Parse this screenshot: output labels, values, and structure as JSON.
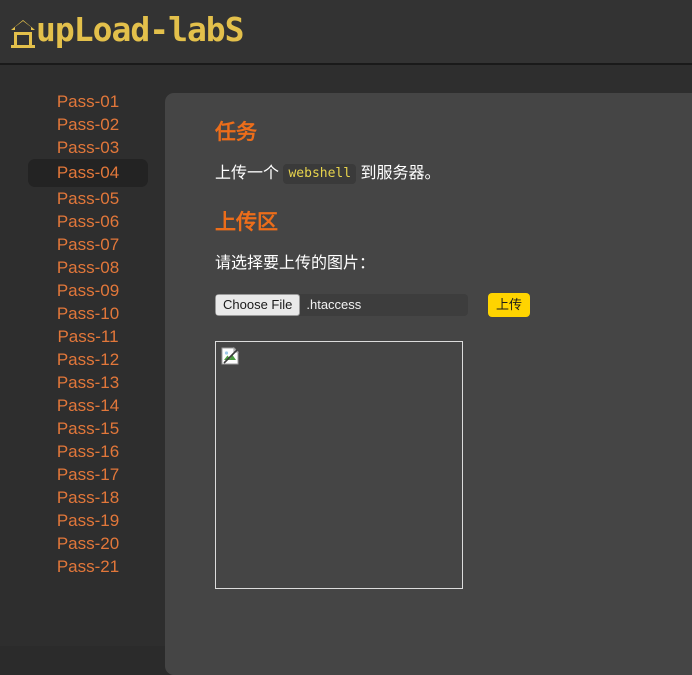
{
  "header": {
    "logo_text": "upLoad-labS"
  },
  "sidebar": {
    "items": [
      {
        "label": "Pass-01",
        "active": false
      },
      {
        "label": "Pass-02",
        "active": false
      },
      {
        "label": "Pass-03",
        "active": false
      },
      {
        "label": "Pass-04",
        "active": true
      },
      {
        "label": "Pass-05",
        "active": false
      },
      {
        "label": "Pass-06",
        "active": false
      },
      {
        "label": "Pass-07",
        "active": false
      },
      {
        "label": "Pass-08",
        "active": false
      },
      {
        "label": "Pass-09",
        "active": false
      },
      {
        "label": "Pass-10",
        "active": false
      },
      {
        "label": "Pass-11",
        "active": false
      },
      {
        "label": "Pass-12",
        "active": false
      },
      {
        "label": "Pass-13",
        "active": false
      },
      {
        "label": "Pass-14",
        "active": false
      },
      {
        "label": "Pass-15",
        "active": false
      },
      {
        "label": "Pass-16",
        "active": false
      },
      {
        "label": "Pass-17",
        "active": false
      },
      {
        "label": "Pass-18",
        "active": false
      },
      {
        "label": "Pass-19",
        "active": false
      },
      {
        "label": "Pass-20",
        "active": false
      },
      {
        "label": "Pass-21",
        "active": false
      }
    ]
  },
  "main": {
    "task_title": "任务",
    "task_text_before": "上传一个",
    "task_code": "webshell",
    "task_text_after": "到服务器。",
    "upload_title": "上传区",
    "upload_label": "请选择要上传的图片：",
    "file_button_label": "Choose File",
    "file_name": ".htaccess",
    "submit_label": "上传",
    "preview_icon": "broken-image-icon"
  },
  "colors": {
    "accent_orange": "#ec6d1a",
    "nav_orange": "#e2773a",
    "logo_gold": "#e3c04b",
    "submit_yellow": "#ffd400",
    "code_yellow": "#e8d44d",
    "page_bg": "#2e2e2e",
    "header_bg": "#333333",
    "content_bg": "#454545",
    "active_item_bg": "#232323"
  }
}
